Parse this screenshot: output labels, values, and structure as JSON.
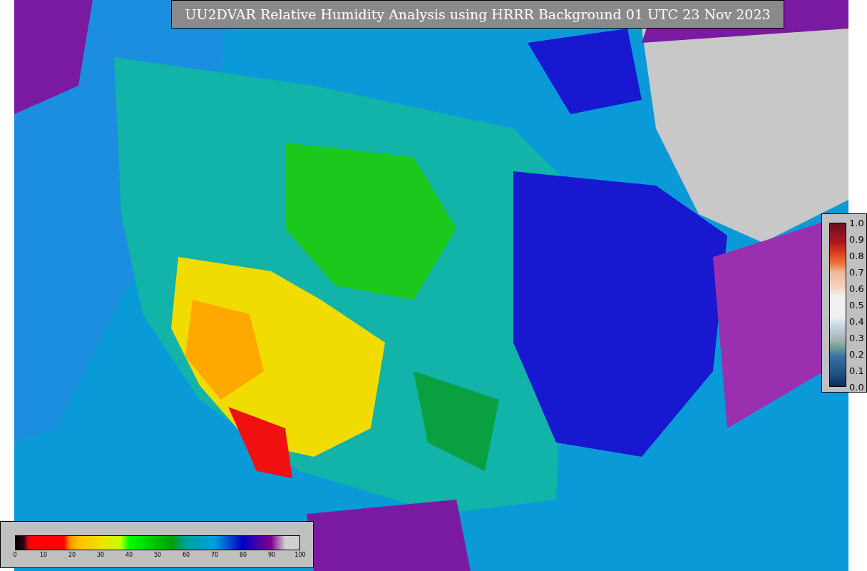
{
  "title": "UU2DVAR Relative Humidity Analysis using HRRR Background 01 UTC 23 Nov 2023",
  "humidity_colorbar": {
    "ticks": [
      "0",
      "10",
      "20",
      "30",
      "40",
      "50",
      "60",
      "70",
      "80",
      "90",
      "100"
    ]
  },
  "fraction_colorbar": {
    "ticks": [
      "1.0",
      "0.9",
      "0.8",
      "0.7",
      "0.6",
      "0.5",
      "0.4",
      "0.3",
      "0.2",
      "0.1",
      "0.0"
    ]
  }
}
